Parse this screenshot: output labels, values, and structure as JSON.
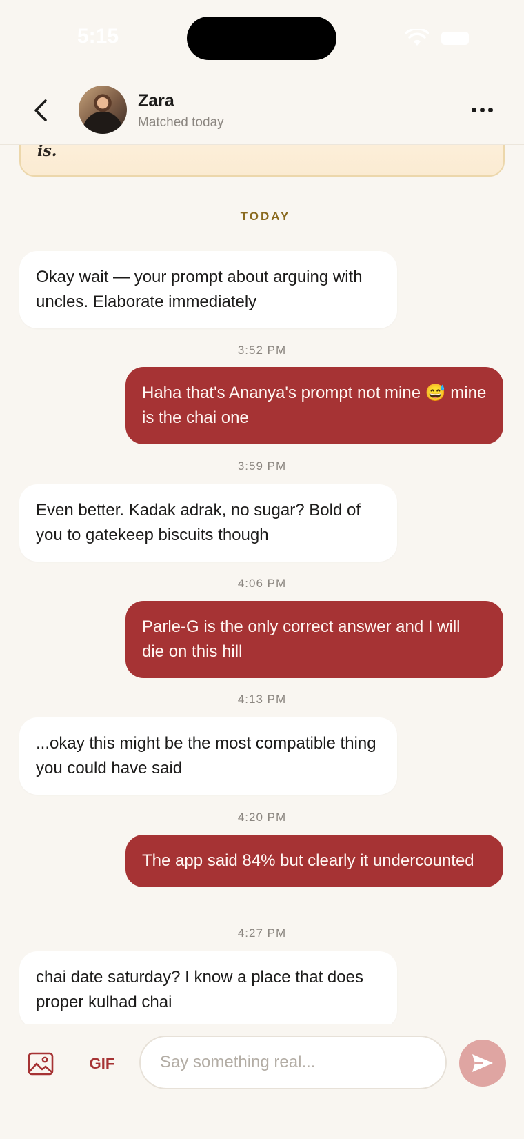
{
  "status_bar": {
    "time": "5:15"
  },
  "header": {
    "name": "Zara",
    "match_status": "Matched today"
  },
  "prompt_card": {
    "visible_text": "is."
  },
  "divider": {
    "label": "TODAY"
  },
  "messages": [
    {
      "direction": "in",
      "text": "Okay wait — your prompt about arguing with uncles. Elaborate immediately",
      "time": "3:52 PM"
    },
    {
      "direction": "out",
      "text": "Haha that's Ananya's prompt not mine 😅 mine is the chai one",
      "time": "3:59 PM"
    },
    {
      "direction": "in",
      "text": "Even better. Kadak adrak, no sugar? Bold of you to gatekeep biscuits though",
      "time": "4:06 PM"
    },
    {
      "direction": "out",
      "text": "Parle-G is the only correct answer and I will die on this hill",
      "time": "4:13 PM"
    },
    {
      "direction": "in",
      "text": "...okay this might be the most compatible thing you could have said",
      "time": "4:20 PM"
    },
    {
      "direction": "out",
      "text": "The app said 84% but clearly it undercounted",
      "time": "4:27 PM"
    },
    {
      "direction": "in",
      "text": "chai date saturday? I know a place that does proper kulhad chai"
    }
  ],
  "composer": {
    "gif_label": "GIF",
    "placeholder": "Say something real...",
    "value": ""
  },
  "icons": {
    "back": "chevron-left-icon",
    "more": "ellipsis-icon",
    "image": "image-icon",
    "send": "send-icon"
  },
  "colors": {
    "background": "#f9f6f1",
    "outgoing_bubble": "#a63334",
    "incoming_bubble": "#ffffff",
    "accent_gold": "#8a6a1f",
    "send_button": "#dfa5a2"
  }
}
